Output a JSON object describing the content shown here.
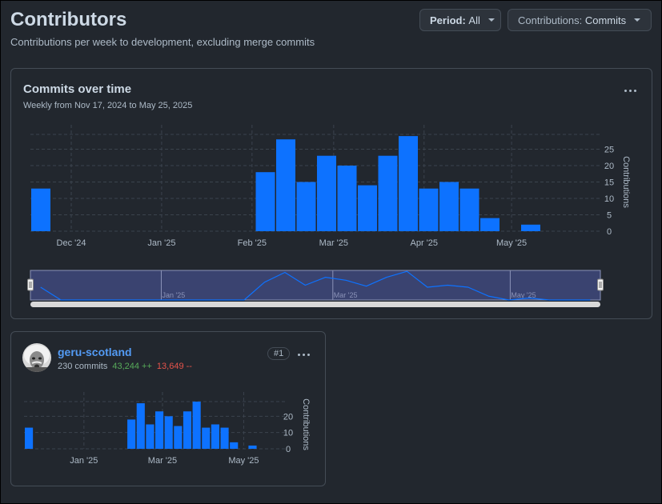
{
  "page": {
    "title": "Contributors",
    "subtitle": "Contributions per week to development, excluding merge commits"
  },
  "filters": {
    "period_label": "Period:",
    "period_value": "All",
    "contrib_label": "Contributions:",
    "contrib_value": "Commits"
  },
  "main_card": {
    "title": "Commits over time",
    "subtitle": "Weekly from Nov 17, 2024 to May 25, 2025"
  },
  "colors": {
    "bar": "#0d72ff",
    "grid": "#3b434d",
    "add": "#57ab5a",
    "del": "#e5534b",
    "link": "#539bf5"
  },
  "chart_data": [
    {
      "type": "bar",
      "title": "",
      "ylabel": "Contributions",
      "ylim": [
        0,
        30
      ],
      "yticks": [
        0,
        5,
        10,
        15,
        20,
        25
      ],
      "x": [
        "2024-11-17",
        "2024-11-24",
        "2024-12-01",
        "2024-12-08",
        "2024-12-15",
        "2024-12-22",
        "2024-12-29",
        "2025-01-05",
        "2025-01-12",
        "2025-01-19",
        "2025-01-26",
        "2025-02-02",
        "2025-02-09",
        "2025-02-16",
        "2025-02-23",
        "2025-03-02",
        "2025-03-09",
        "2025-03-16",
        "2025-03-23",
        "2025-03-30",
        "2025-04-06",
        "2025-04-13",
        "2025-04-20",
        "2025-04-27",
        "2025-05-04",
        "2025-05-11",
        "2025-05-18",
        "2025-05-25"
      ],
      "values": [
        13,
        0,
        0,
        0,
        0,
        0,
        0,
        0,
        0,
        0,
        0,
        18,
        28,
        15,
        23,
        20,
        14,
        23,
        29,
        13,
        15,
        13,
        4,
        0,
        2,
        0,
        0,
        0
      ],
      "xtick_labels": [
        "Dec '24",
        "Jan '25",
        "Feb '25",
        "Mar '25",
        "Apr '25",
        "May '25"
      ],
      "navigator_labels": [
        "Jan '25",
        "Mar '25",
        "May '25"
      ]
    },
    {
      "type": "bar",
      "title": "",
      "ylabel": "Contributions",
      "ylim": [
        0,
        30
      ],
      "yticks": [
        0,
        10,
        20
      ],
      "x": [
        "2024-11-17",
        "2024-11-24",
        "2024-12-01",
        "2024-12-08",
        "2024-12-15",
        "2024-12-22",
        "2024-12-29",
        "2025-01-05",
        "2025-01-12",
        "2025-01-19",
        "2025-01-26",
        "2025-02-02",
        "2025-02-09",
        "2025-02-16",
        "2025-02-23",
        "2025-03-02",
        "2025-03-09",
        "2025-03-16",
        "2025-03-23",
        "2025-03-30",
        "2025-04-06",
        "2025-04-13",
        "2025-04-20",
        "2025-04-27",
        "2025-05-04",
        "2025-05-11",
        "2025-05-18",
        "2025-05-25"
      ],
      "values": [
        13,
        0,
        0,
        0,
        0,
        0,
        0,
        0,
        0,
        0,
        0,
        18,
        28,
        15,
        23,
        20,
        14,
        23,
        29,
        13,
        15,
        13,
        4,
        0,
        2,
        0,
        0,
        0
      ],
      "xtick_labels": [
        "Jan '25",
        "Mar '25",
        "May '25"
      ]
    }
  ],
  "contributor": {
    "name": "geru-scotland",
    "commits": "230 commits",
    "additions": "43,244 ++",
    "deletions": "13,649 --",
    "rank": "#1"
  }
}
